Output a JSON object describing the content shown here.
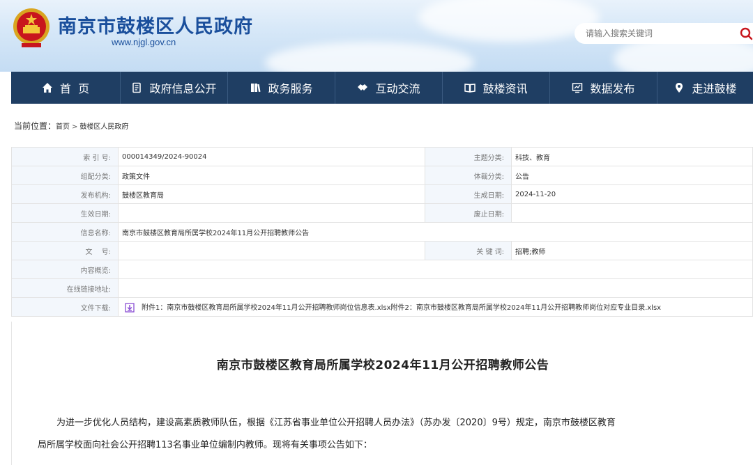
{
  "header": {
    "site_title": "南京市鼓楼区人民政府",
    "site_url": "www.njgl.gov.cn",
    "search_placeholder": "请输入搜索关键词"
  },
  "nav": [
    {
      "label": "首  页",
      "icon": "home-icon"
    },
    {
      "label": "政府信息公开",
      "icon": "document-icon"
    },
    {
      "label": "政务服务",
      "icon": "book-icon"
    },
    {
      "label": "互动交流",
      "icon": "handshake-icon"
    },
    {
      "label": "鼓楼资讯",
      "icon": "open-book-icon"
    },
    {
      "label": "数据发布",
      "icon": "chart-monitor-icon"
    },
    {
      "label": "走进鼓楼",
      "icon": "location-pin-icon"
    }
  ],
  "breadcrumb": {
    "label": "当前位置：",
    "home": "首页",
    "sep": ">",
    "current": "鼓楼区人民政府"
  },
  "meta": {
    "index_no_label": "索 引 号:",
    "index_no": "000014349/2024-90024",
    "topic_label": "主题分类:",
    "topic": "科技、教育",
    "org_cat_label": "组配分类:",
    "org_cat": "政策文件",
    "genre_label": "体裁分类:",
    "genre": "公告",
    "publisher_label": "发布机构:",
    "publisher": "鼓楼区教育局",
    "created_label": "生成日期:",
    "created": "2024-11-20",
    "effective_label": "生效日期:",
    "effective": "",
    "expire_label": "废止日期:",
    "expire": "",
    "name_label": "信息名称:",
    "name": "南京市鼓楼区教育局所属学校2024年11月公开招聘教师公告",
    "doc_no_label": "文　 号:",
    "doc_no": "",
    "keywords_label": "关 键 词:",
    "keywords": "招聘;教师",
    "summary_label": "内容概览:",
    "summary": "",
    "link_label": "在线链接地址:",
    "link": "",
    "download_label": "文件下载:",
    "download": "附件1：南京市鼓楼区教育局所属学校2024年11月公开招聘教师岗位信息表.xlsx附件2：南京市鼓楼区教育局所属学校2024年11月公开招聘教师岗位对应专业目录.xlsx"
  },
  "article": {
    "title": "南京市鼓楼区教育局所属学校2024年11月公开招聘教师公告",
    "para1_line1": "为进一步优化人员结构，建设高素质教师队伍，根据《江苏省事业单位公开招聘人员办法》（苏办发〔2020〕9号）规定，南京市鼓楼区教育",
    "para1_line2": "局所属学校面向社会公开招聘113名事业单位编制内教师。现将有关事项公告如下："
  },
  "colors": {
    "nav_bg": "#1f3e63",
    "title_blue": "#1a4f9c",
    "meta_label_bg": "#f3f7fc"
  }
}
